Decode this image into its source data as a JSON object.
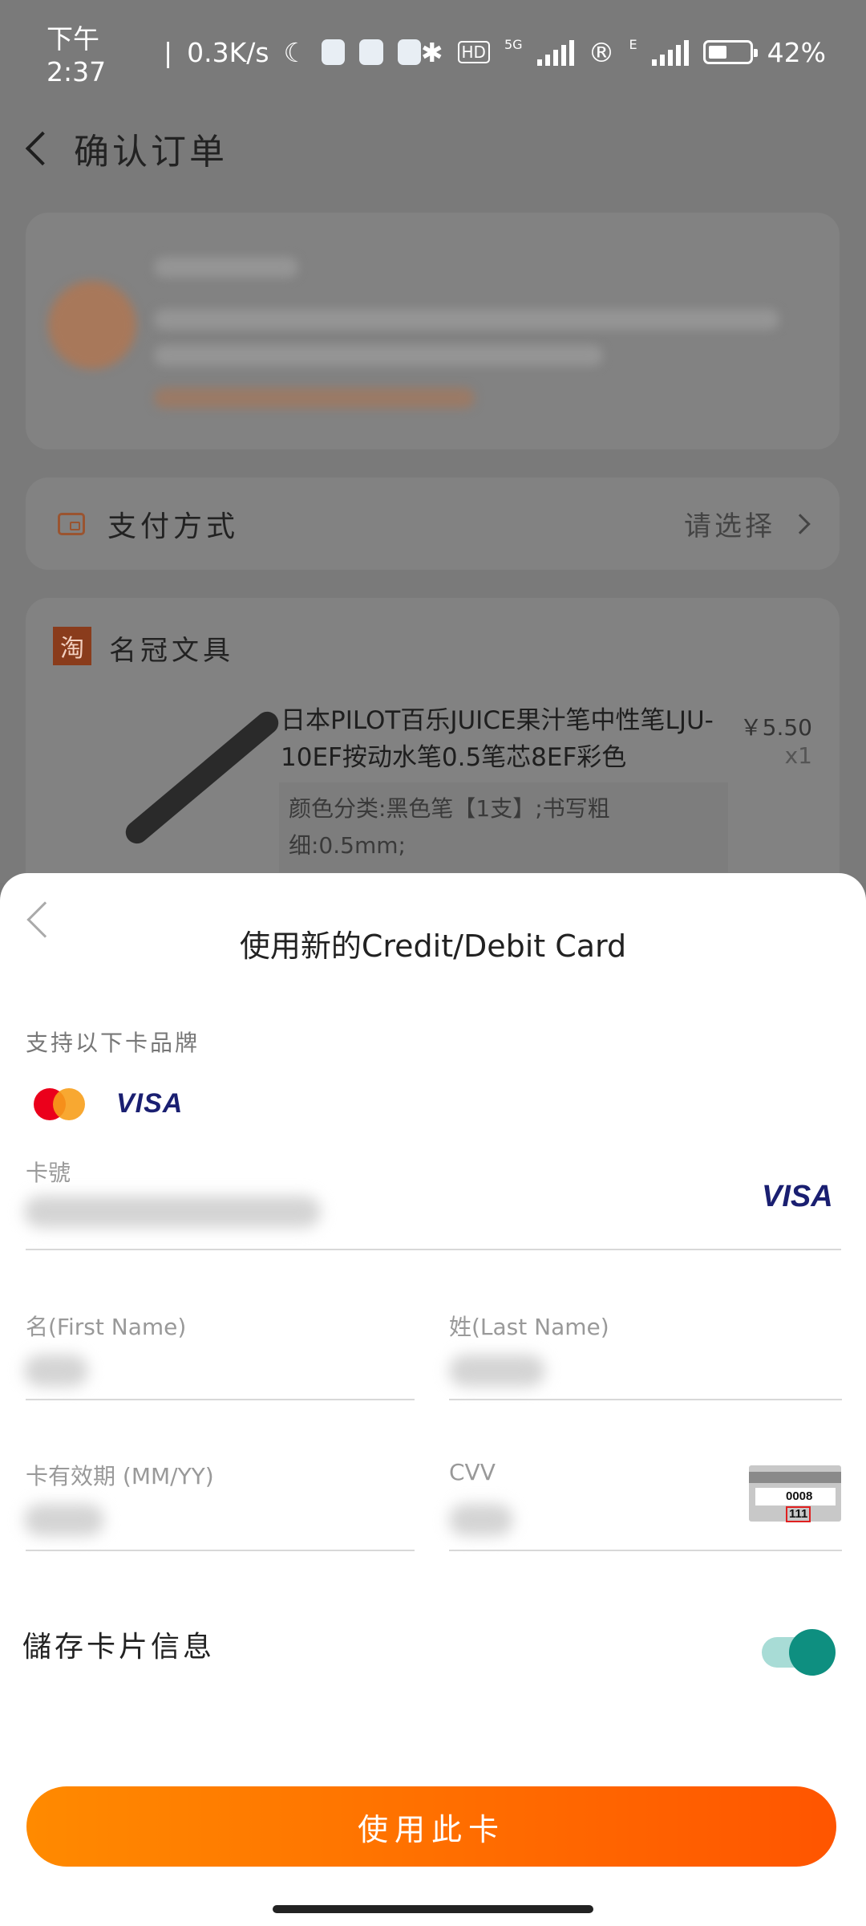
{
  "status_bar": {
    "time": "下午2:37",
    "speed": "0.3K/s",
    "network_5g": "5G",
    "network_e": "E",
    "hd": "HD",
    "battery": "42%"
  },
  "header": {
    "title": "确认订单"
  },
  "payment": {
    "label": "支付方式",
    "value": "请选择"
  },
  "shop": {
    "icon_text": "淘",
    "name": "名冠文具",
    "product_title": "日本PILOT百乐JUICE果汁笔中性笔LJU-10EF按动水笔0.5笔芯8EF彩色",
    "price": "￥5.50",
    "quantity": "x1",
    "spec": "颜色分类:黑色笔【1支】;书写粗细:0.5mm;"
  },
  "sheet": {
    "title": "使用新的Credit/Debit Card",
    "supported_label": "支持以下卡品牌",
    "brands": [
      "mastercard",
      "VISA"
    ],
    "card_number_label": "卡號",
    "detected_brand": "VISA",
    "first_name_label": "名(First Name)",
    "last_name_label": "姓(Last Name)",
    "expiry_label": "卡有效期 (MM/YY)",
    "cvv_label": "CVV",
    "cvv_hint": {
      "number": "0008",
      "cvv": "111"
    },
    "save_label": "儲存卡片信息",
    "save_enabled": true,
    "submit_label": "使用此卡"
  },
  "colors": {
    "accent_start": "#ff8a00",
    "accent_end": "#ff5500",
    "toggle_on": "#0e8f80",
    "visa_blue": "#1a1f71"
  }
}
